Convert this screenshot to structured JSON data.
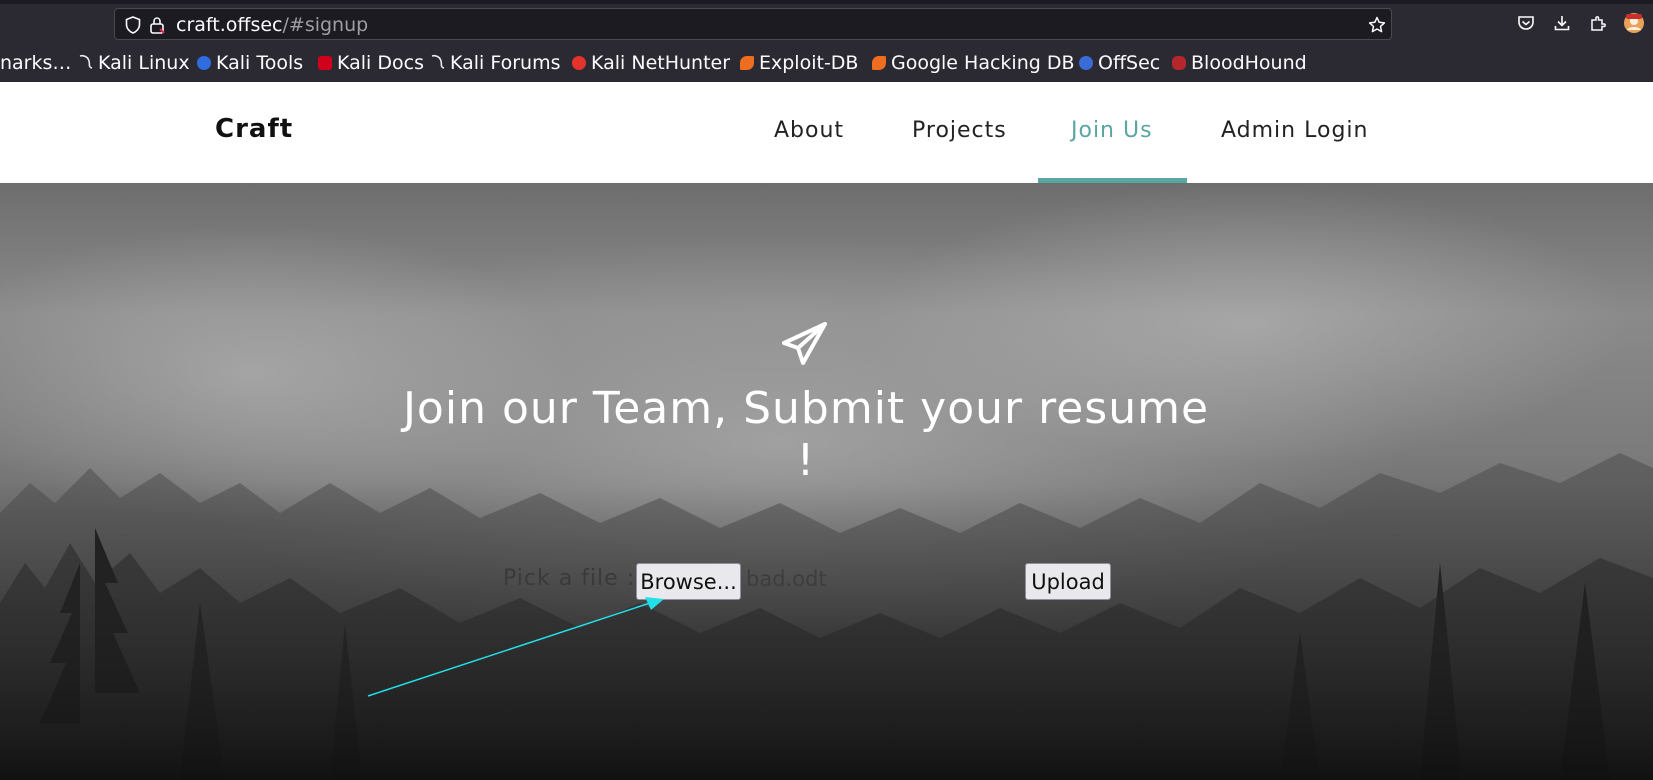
{
  "browser": {
    "url_host": "craft.offsec",
    "url_path": "/#signup",
    "bookmarks": [
      {
        "label": "narks…",
        "color": ""
      },
      {
        "label": "Kali Linux",
        "color": "#367bf0"
      },
      {
        "label": "Kali Tools",
        "color": "#2f6ce0"
      },
      {
        "label": "Kali Docs",
        "color": "#d0021b"
      },
      {
        "label": "Kali Forums",
        "color": "#367bf0"
      },
      {
        "label": "Kali NetHunter",
        "color": "#e4322c"
      },
      {
        "label": "Exploit-DB",
        "color": "#ee6d1f"
      },
      {
        "label": "Google Hacking DB",
        "color": "#ee6d1f"
      },
      {
        "label": "OffSec",
        "color": "#3b6bd6"
      },
      {
        "label": "BloodHound",
        "color": "#b5272d"
      }
    ]
  },
  "site": {
    "brand": "Craft",
    "nav": [
      {
        "label": "About",
        "active": false
      },
      {
        "label": "Projects",
        "active": false
      },
      {
        "label": "Join Us",
        "active": true
      },
      {
        "label": "Admin Login",
        "active": false
      }
    ],
    "accent_color": "#5aa6a1"
  },
  "hero": {
    "headline_line1": "Join our Team, Submit your resume",
    "headline_line2": "!",
    "pick_label": "Pick a file :",
    "browse_label": "Browse...",
    "filename": "bad.odt",
    "upload_label": "Upload"
  },
  "icons": {
    "shield": "shield-icon",
    "lock": "lock-icon",
    "star": "star-icon",
    "pocket": "pocket-icon",
    "download": "download-icon",
    "extensions": "extensions-icon",
    "plane": "paper-plane-icon"
  }
}
